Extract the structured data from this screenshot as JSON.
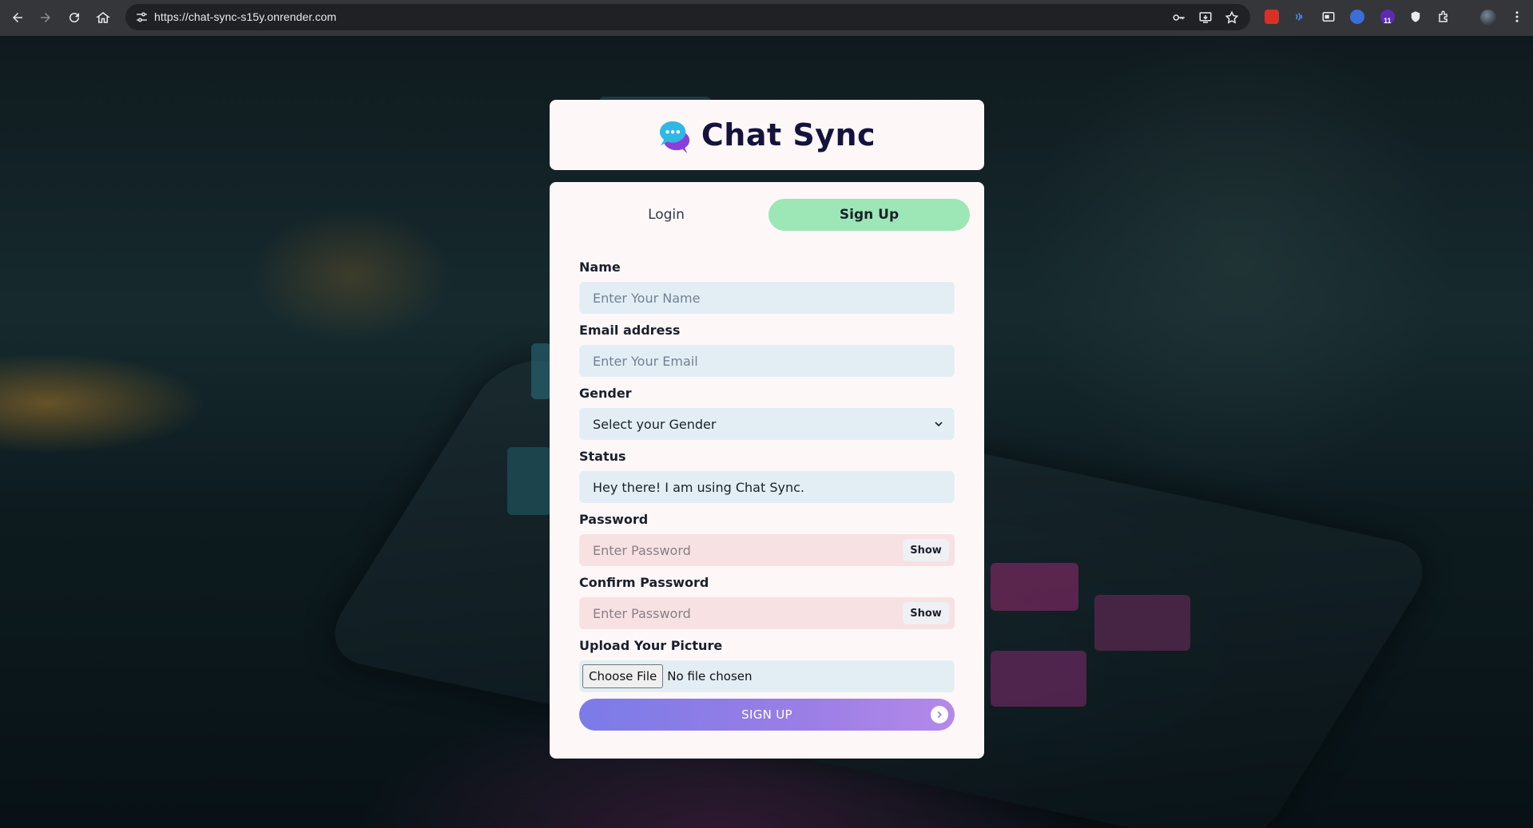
{
  "browser": {
    "url": "https://chat-sync-s15y.onrender.com",
    "extension_badge": "11"
  },
  "app": {
    "title": "Chat Sync"
  },
  "tabs": {
    "login": "Login",
    "signup": "Sign Up",
    "active": "signup"
  },
  "form": {
    "name": {
      "label": "Name",
      "placeholder": "Enter Your Name",
      "value": ""
    },
    "email": {
      "label": "Email address",
      "placeholder": "Enter Your Email",
      "value": ""
    },
    "gender": {
      "label": "Gender",
      "selected": "Select your Gender"
    },
    "status": {
      "label": "Status",
      "value": "Hey there! I am using Chat Sync."
    },
    "password": {
      "label": "Password",
      "placeholder": "Enter Password",
      "toggle": "Show"
    },
    "confirm_password": {
      "label": "Confirm Password",
      "placeholder": "Enter Password",
      "toggle": "Show"
    },
    "picture": {
      "label": "Upload Your Picture",
      "button": "Choose File",
      "status": "No file chosen"
    },
    "submit": "SIGN UP"
  },
  "colors": {
    "active_tab": "#9de6b6",
    "card": "#fdf8f7",
    "input_blue": "#e3eef4",
    "input_pink": "#f7e1e3",
    "button_gradient_start": "#7b7be8",
    "button_gradient_end": "#b489e8",
    "title": "#15133d"
  },
  "icons": {
    "back": "back-arrow-icon",
    "forward": "forward-arrow-icon",
    "reload": "reload-icon",
    "home": "home-icon",
    "site_info": "tune-icon",
    "password_key": "key-icon",
    "install": "install-app-icon",
    "bookmark": "star-icon",
    "extensions": "puzzle-icon",
    "menu": "kebab-menu-icon",
    "logo": "chat-bubbles-icon",
    "submit": "chevron-right-circle-icon"
  }
}
